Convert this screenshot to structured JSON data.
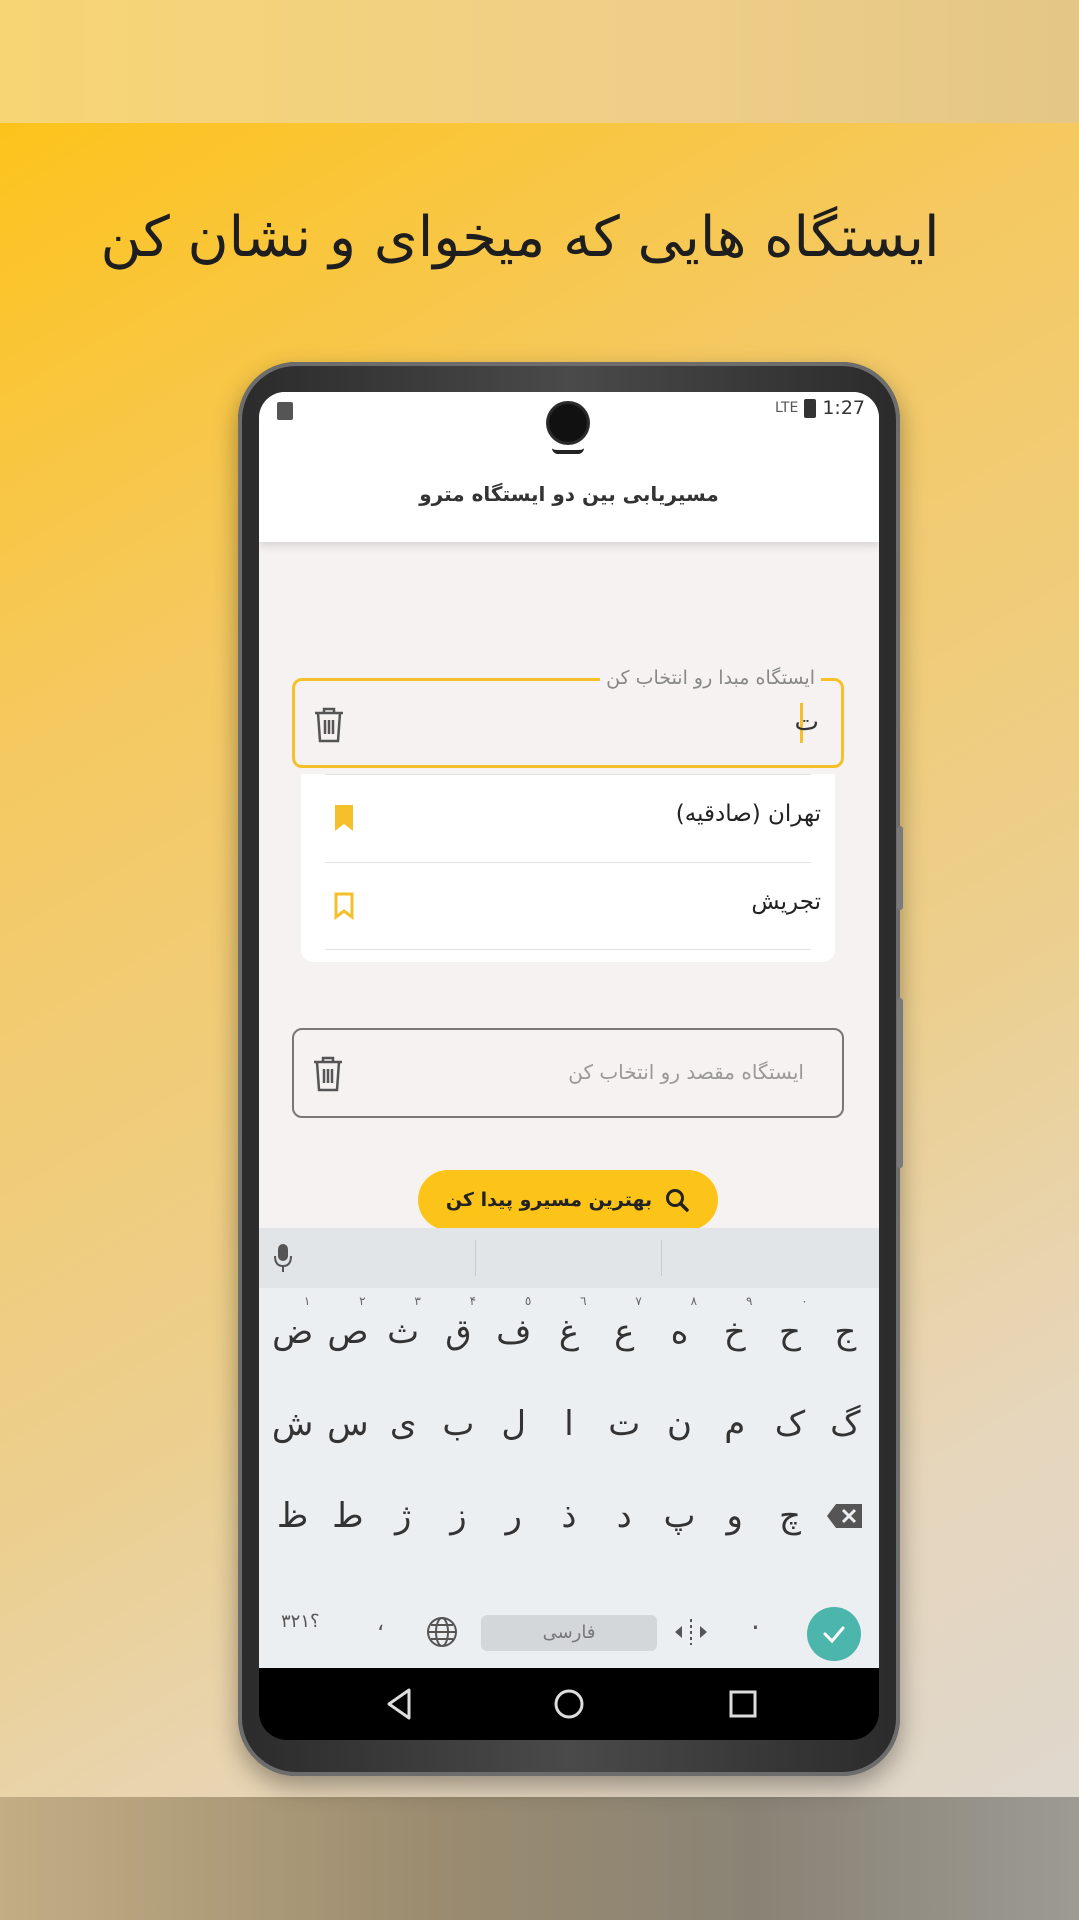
{
  "headline": "ایستگاه هایی که میخوای و نشان کن",
  "status_bar": {
    "signal": "LTE",
    "time": "1:27"
  },
  "app_bar": {
    "title": "مسیریابی بین دو ایستگاه مترو"
  },
  "origin_field": {
    "label": "ایستگاه مبدا رو انتخاب کن",
    "value": "ت"
  },
  "suggestions": [
    {
      "label": "تهران (صادقیه)",
      "bookmarked": true
    },
    {
      "label": "تجریش",
      "bookmarked": false
    }
  ],
  "destination_field": {
    "placeholder": "ایستگاه مقصد رو انتخاب کن"
  },
  "search_button": {
    "label": "بهترین مسیرو پیدا کن"
  },
  "keyboard": {
    "row1": [
      {
        "k": "ج",
        "h": ""
      },
      {
        "k": "ح",
        "h": "٠"
      },
      {
        "k": "خ",
        "h": "٩"
      },
      {
        "k": "ه",
        "h": "٨"
      },
      {
        "k": "ع",
        "h": "٧"
      },
      {
        "k": "غ",
        "h": "٦"
      },
      {
        "k": "ف",
        "h": "٥"
      },
      {
        "k": "ق",
        "h": "۴"
      },
      {
        "k": "ث",
        "h": "٣"
      },
      {
        "k": "ص",
        "h": "٢"
      },
      {
        "k": "ض",
        "h": "١"
      }
    ],
    "row2": [
      "گ",
      "ک",
      "م",
      "ن",
      "ت",
      "ا",
      "ل",
      "ب",
      "ی",
      "س",
      "ش"
    ],
    "row3": [
      "چ",
      "و",
      "پ",
      "د",
      "ذ",
      "ر",
      "ز",
      "ژ",
      "ط",
      "ظ"
    ],
    "numbers_key": "؟٣٢١",
    "comma_key": "،",
    "space_label": "فارسی",
    "period_key": "."
  },
  "colors": {
    "accent": "#fcc419",
    "enter": "#4db6ac"
  }
}
